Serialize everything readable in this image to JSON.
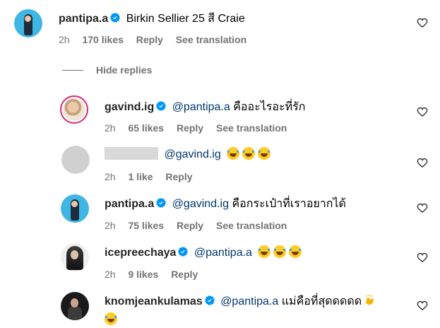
{
  "top_comment": {
    "username": "pantipa.a",
    "text": "Birkin Sellier 25 สี Craie",
    "time": "2h",
    "likes": "170 likes",
    "reply": "Reply",
    "translate": "See translation"
  },
  "hide_replies": "Hide replies",
  "replies": [
    {
      "username": "gavind.ig",
      "mention": "@pantipa.a",
      "text": "คืออะไรอะที่รัก",
      "time": "2h",
      "likes": "65 likes",
      "reply": "Reply",
      "translate": "See translation"
    },
    {
      "username": "",
      "mention": "@gavind.ig",
      "text": "",
      "time": "2h",
      "likes": "1 like",
      "reply": "Reply"
    },
    {
      "username": "pantipa.a",
      "mention": "@gavind.ig",
      "text": "คือกระเป๋าที่เราอยากได้",
      "time": "2h",
      "likes": "75 likes",
      "reply": "Reply",
      "translate": "See translation"
    },
    {
      "username": "icepreechaya",
      "mention": "@pantipa.a",
      "text": "",
      "time": "2h",
      "likes": "9 likes",
      "reply": "Reply"
    },
    {
      "username": "knomjeankulamas",
      "mention": "@pantipa.a",
      "text": "แม่คือที่สุดดดดด"
    }
  ],
  "colors": {
    "username": "#262626",
    "mention": "#00376b",
    "meta": "#737373",
    "verified": "#0095f6",
    "story_ring": "#d62976"
  }
}
